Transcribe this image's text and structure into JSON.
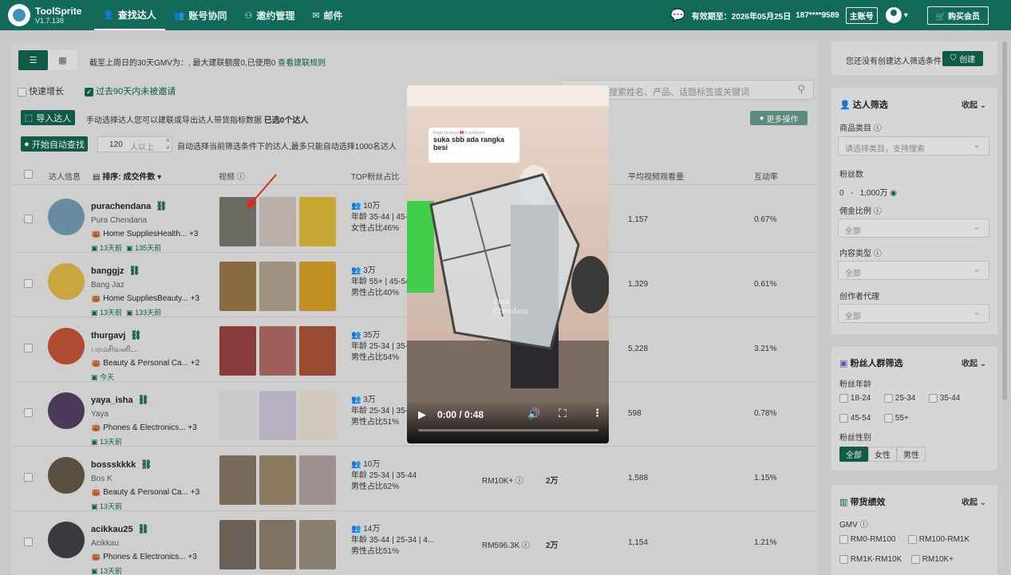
{
  "app": {
    "name": "ToolSprite",
    "version": "V1.7.138"
  },
  "nav": [
    {
      "icon": "user-search-icon",
      "label": "查找达人"
    },
    {
      "icon": "users-icon",
      "label": "账号协同"
    },
    {
      "icon": "invite-icon",
      "label": "邀约管理"
    },
    {
      "icon": "mail-icon",
      "label": "邮件"
    }
  ],
  "account": {
    "expiry_label": "有效期至：2026年05月25日",
    "phone": "187****9589",
    "role_badge": "主账号",
    "buy_label": "购买会员"
  },
  "toolbar": {
    "gmv_notice": "截至上周日的30天GMV为：, 最大建联额度0,已使用0",
    "view_rules": "查看建联规则",
    "fast_growth": "快速增长",
    "not_invited_90": "过去90天内未被邀请",
    "search_placeholder": "搜索姓名、产品、话题标签或关键词",
    "import_label": "导入达人",
    "import_hint": "手动选择达人您可以建联或导出达人带货指标数据",
    "selected_count": "已选0个达人",
    "more_actions": "更多操作",
    "auto_find": "开始自动查找",
    "auto_count": "120",
    "auto_count_unit": "人以上",
    "auto_hint": "自动选择当前筛选条件下的达人,最多只能自动选择1000名达人"
  },
  "table": {
    "headers": {
      "info": "达人信息",
      "sort": "排序: 成交件数",
      "video": "视频",
      "top_fans": "TOP粉丝占比",
      "avg_views": "平均视频观看量",
      "engagement": "互动率"
    },
    "rows": [
      {
        "name": "purachendana",
        "display": "Pura Chendana",
        "category": "Home SuppliesHealth...",
        "more": "+3",
        "time1": "13天前",
        "time2": "135天前",
        "fans": "10万",
        "age": "年龄 35-44 | 45-54...",
        "gender": "女性占比46%",
        "gmv": "",
        "units": "",
        "views": "1,157",
        "rate": "0.67%",
        "avatar_color": "#6a8aa0",
        "thumbs": [
          "#6b6a62",
          "#b8b0a8",
          "#c8a832"
        ]
      },
      {
        "name": "banggjz",
        "display": "Bang Jaz",
        "category": "Home SuppliesBeauty...",
        "more": "+3",
        "time1": "13天前",
        "time2": "133天前",
        "fans": "3万",
        "age": "年龄 55+ | 45-54...",
        "gender": "男性占比40%",
        "gmv": "",
        "units": "",
        "views": "1,329",
        "rate": "0.61%",
        "avatar_color": "#c9a640",
        "thumbs": [
          "#8a6a40",
          "#a09080",
          "#c09020"
        ]
      },
      {
        "name": "thurgavj",
        "display": "பரமசிவனி...",
        "category": "Beauty & Personal Ca...",
        "more": "+2",
        "time1": "今天",
        "time2": "",
        "fans": "35万",
        "age": "年龄 25-34 | 35-44...",
        "gender": "男性占比54%",
        "gmv": "",
        "units": "",
        "views": "5,228",
        "rate": "3.21%",
        "avatar_color": "#b04a30",
        "thumbs": [
          "#8a3a3a",
          "#a0605a",
          "#9a4a30"
        ]
      },
      {
        "name": "yaya_isha",
        "display": "Yaya",
        "category": "Phones & Electronics...",
        "more": "+3",
        "time1": "13天前",
        "time2": "",
        "fans": "3万",
        "age": "年龄 25-34 | 35-44...",
        "gender": "男性占比51%",
        "gmv": "",
        "units": "",
        "views": "598",
        "rate": "0.78%",
        "avatar_color": "#4a3a5a",
        "thumbs": [
          "#c8c8c8",
          "#b8b0c0",
          "#d0c8b8"
        ]
      },
      {
        "name": "bossskkkk",
        "display": "Bos K",
        "category": "Beauty & Personal Ca...",
        "more": "+3",
        "time1": "13天前",
        "time2": "",
        "fans": "10万",
        "age": "年龄 25-34 | 35-44",
        "gender": "男性占比62%",
        "gmv": "RM10K+",
        "units": "2万",
        "views": "1,588",
        "rate": "1.15%",
        "avatar_color": "#5a5040",
        "thumbs": [
          "#7a6a5a",
          "#8a7a60",
          "#a09090"
        ]
      },
      {
        "name": "acikkau25",
        "display": "Acikkau",
        "category": "Phones & Electronics...",
        "more": "+3",
        "time1": "13天前",
        "time2": "",
        "fans": "14万",
        "age": "年龄 35-44 | 25-34 | 4...",
        "gender": "男性占比51%",
        "gmv": "RM596.3K",
        "units": "2万",
        "views": "1,154",
        "rate": "1.21%",
        "avatar_color": "#3a3a40",
        "thumbs": [
          "#6a6058",
          "#807060",
          "#8a8070"
        ]
      }
    ]
  },
  "sidebar": {
    "no_filter_text": "您还没有创建达人筛选条件",
    "create_label": "创建",
    "creator_filter": "达人筛选",
    "collapse": "收起",
    "category_label": "商品类目",
    "category_placeholder": "请选择类目，支持搜索",
    "followers_label": "粉丝数",
    "followers_min": "0",
    "followers_dash": "-",
    "followers_max": "1,000万",
    "commission_label": "佣金比例",
    "content_type_label": "内容类型",
    "agency_label": "创作者代理",
    "all": "全部",
    "audience_filter": "粉丝人群筛选",
    "age_label": "粉丝年龄",
    "ages": [
      "18-24",
      "25-34",
      "35-44",
      "45-54",
      "55+"
    ],
    "gender_label": "粉丝性别",
    "genders": [
      "全部",
      "女性",
      "男性"
    ],
    "sales_title": "带货绩效",
    "gmv_label": "GMV",
    "gmv_ranges": [
      "RM0-RM100",
      "RM100-RM1K",
      "RM1K-RM10K",
      "RM10K+"
    ]
  },
  "video": {
    "reply_to": "Reply to rizzzy🎀's comment",
    "comment": "suka sbb ada rangka besi",
    "watermark": "Pura Chendana",
    "time": "0:00 / 0:48",
    "progress": 0.0
  }
}
